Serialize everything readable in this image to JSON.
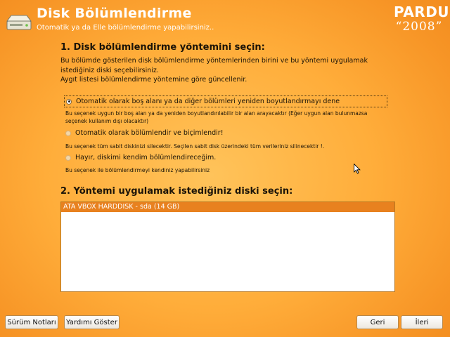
{
  "header": {
    "title": "Disk Bölümlendirme",
    "subtitle": "Otomatik ya da Elle bölümlendirme yapabilirsiniz..",
    "logo_word": "PARDUS",
    "logo_year": "“2008”"
  },
  "section1": {
    "title": "1. Disk bölümlendirme yöntemini seçin:",
    "intro_line1": "Bu bölümde gösterilen disk bölümlendirme yöntemlerinden birini ve bu yöntemi uygulamak",
    "intro_line2": "istediğiniz diski seçebilirsiniz.",
    "intro_line3": "Aygıt listesi bölümlendirme yöntemine göre güncellenir.",
    "options": [
      {
        "label": "Otomatik olarak boş alanı ya da diğer bölümleri yeniden boyutlandırmayı dene",
        "desc_line1": "Bu seçenek uygun bir boş alan ya da yeniden boyutlandırılabilir bir alan arayacaktır (Eğer uygun alan bulunmazsa",
        "desc_line2": "seçenek kullanım dışı olacaktır)",
        "selected": true
      },
      {
        "label": "Otomatik olarak bölümlendir ve biçimlendir!",
        "desc_line1": "Bu seçenek tüm sabit diskinizi silecektir. Seçilen sabit disk üzerindeki tüm verileriniz silinecektir !.",
        "selected": false
      },
      {
        "label": "Hayır, diskimi kendim bölümlendireceğim.",
        "desc_line1": "Bu seçenek ile bölümlendirmeyi kendiniz yapabilirsiniz",
        "selected": false
      }
    ]
  },
  "section2": {
    "title": "2. Yöntemi uygulamak istediğiniz diski seçin:",
    "disks": [
      "ATA VBOX HARDDISK - sda (14 GB)"
    ]
  },
  "buttons": {
    "release_notes": "Sürüm Notları",
    "show_help": "Yardımı Göster",
    "back": "Geri",
    "next": "İleri"
  },
  "colors": {
    "background": "#f9a236",
    "selection": "#e8811f"
  }
}
